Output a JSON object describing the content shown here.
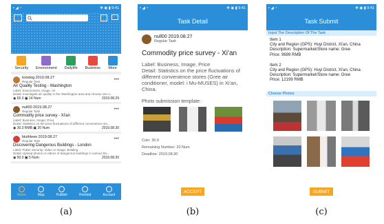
{
  "phone1": {
    "status_left": "▪ ◢ ◔",
    "status_right": "✻ ◉ ▮ 9:41",
    "categories": [
      {
        "label": "Security",
        "color": "#f5a623"
      },
      {
        "label": "Environment",
        "color": "#8e6bc9"
      },
      {
        "label": "Dailylife",
        "color": "#2e9e5b"
      },
      {
        "label": "Business",
        "color": "#e8483f"
      },
      {
        "label": "More",
        "color": "#2a8fd8"
      }
    ],
    "tasks": [
      {
        "user": "tomdog",
        "date": "2019.08.27",
        "type": "Regular Task",
        "title": "Air Quality Testing - Washington",
        "label": "Label: Environment, Image, Air",
        "detail": "Detail: Investigate air quality in the Washington area and choose one o...",
        "coin": "65.0",
        "num": "14 Num",
        "deadline": "2019.08.29"
      },
      {
        "user": "null00",
        "date": "2019.08.27",
        "type": "Regular Task",
        "title": "Commodity price survey - Xi'an",
        "label": "Label: Business, Image, Price",
        "detail": "Detail: Statistics on the price fluctuations of different convenience sto...",
        "coin": "30.0 RMB",
        "num": "20 Num",
        "deadline": "2019.08.30"
      },
      {
        "user": "bluthleee",
        "date": "2019.08.27",
        "type": "Regular Task",
        "title": "Discovering Dangerous Buildings - London",
        "label": "Label: Public Security, Video or Image, Building",
        "detail": "Detail: Upload photos or videos of dangerous buildings in various blo...",
        "coin": "50.0",
        "num": "5 Num",
        "deadline": "2019.08.30"
      }
    ],
    "tabs": [
      "Home",
      "Map",
      "Publish",
      "Remind",
      "Account"
    ]
  },
  "phone2": {
    "status_left": "▪ ◢ ◔",
    "status_right": "✻ ◉ ▮ 9:41",
    "title": "Task Detail",
    "user": "null00",
    "date": "2019.08.27",
    "type": "Regular Task",
    "task_title": "Commodity price survey - Xi'an",
    "label": "Label: Business, Image, Price",
    "detail": "Detail: Statistics on the price fluctuations of different convenience stores (Gree air conditioner, model: i Mu-MUSES) in Xi'an, China.",
    "template_label": "Photo submission template:",
    "coin": "Coin: 30.0",
    "remaining": "Remaining Number: 20 Num",
    "deadline": "Deadline: 2019.08.30",
    "accept": "ACCEPT"
  },
  "phone3": {
    "status_left": "▪ ◢ ◔",
    "status_right": "✻ ◉ ▮ 9:41",
    "title": "Task Submit",
    "section1": "Input The Description Of The Task",
    "items": [
      {
        "name": "Item 1",
        "city": "City and Region (GPS): Huyi District, Xi'an, China",
        "desc": "Description: Supermarket/Store name: Gree",
        "price": "Price: 9699 RMB"
      },
      {
        "name": "Item 2",
        "city": "City and Region (GPS): Huyi District, Xi'an, China",
        "desc": "Description: Supermarket/Store name: Gree",
        "price": "Price: 12199 RMB"
      }
    ],
    "section2": "Choose Photos",
    "submit": "SUBMIT"
  },
  "captions": [
    "(a)",
    "(b)",
    "(c)"
  ]
}
